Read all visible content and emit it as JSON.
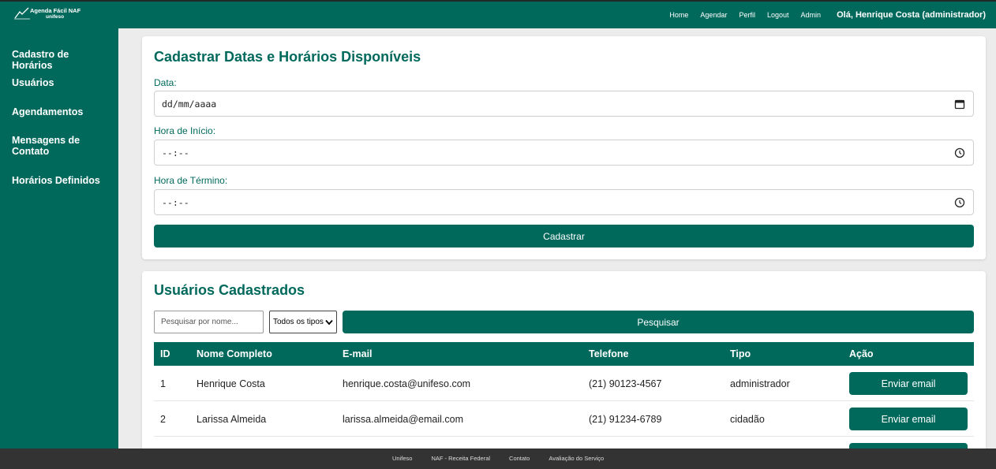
{
  "header": {
    "logo_line1": "Agenda Fácil NAF",
    "logo_line2": "unifeso",
    "nav": [
      "Home",
      "Agendar",
      "Perfil",
      "Logout",
      "Admin"
    ],
    "greeting": "Olá, Henrique Costa (administrador)"
  },
  "sidebar": {
    "items": [
      "Cadastro de Horários",
      "Usuários",
      "Agendamentos",
      "Mensagens de Contato",
      "Horários Definidos"
    ]
  },
  "schedule_form": {
    "title": "Cadastrar Datas e Horários Disponíveis",
    "date_label": "Data:",
    "date_value": "dd/mm/aaaa",
    "start_label": "Hora de Início:",
    "start_value": "--:--",
    "end_label": "Hora de Término:",
    "end_value": "--:--",
    "submit_label": "Cadastrar"
  },
  "users": {
    "title": "Usuários Cadastrados",
    "search_placeholder": "Pesquisar por nome...",
    "type_filter": "Todos os tipos",
    "search_button": "Pesquisar",
    "columns": [
      "ID",
      "Nome Completo",
      "E-mail",
      "Telefone",
      "Tipo",
      "Ação"
    ],
    "rows": [
      {
        "id": "1",
        "name": "Henrique Costa",
        "email": "henrique.costa@unifeso.com",
        "phone": "(21) 90123-4567",
        "type": "administrador",
        "action": "Enviar email"
      },
      {
        "id": "2",
        "name": "Larissa Almeida",
        "email": "larissa.almeida@email.com",
        "phone": "(21) 91234-6789",
        "type": "cidadão",
        "action": "Enviar email"
      }
    ]
  },
  "footer": {
    "links": [
      "Unifeso",
      "NAF - Receita Federal",
      "Contato",
      "Avaliação do Serviço"
    ]
  },
  "colors": {
    "primary": "#00695c",
    "footer": "#333333",
    "background": "#ececec"
  }
}
